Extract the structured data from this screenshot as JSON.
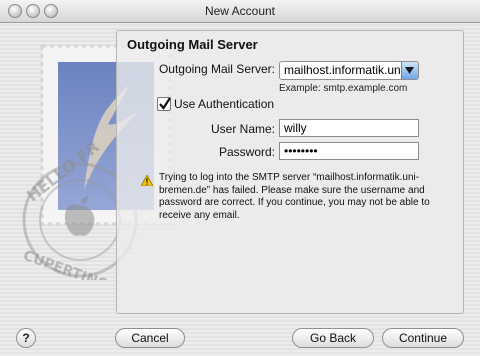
{
  "window": {
    "title": "New Account"
  },
  "panel": {
    "heading": "Outgoing Mail Server",
    "server_label": "Outgoing Mail Server:",
    "server_value": "mailhost.informatik.uni-bremen.de",
    "example": "Example: smtp.example.com",
    "use_auth_label": "Use Authentication",
    "use_auth_checked": true,
    "username_label": "User Name:",
    "username_value": "willy",
    "password_label": "Password:",
    "password_value": "••••••••",
    "warning": "Trying to log into the SMTP server “mailhost.informatik.uni-bremen.de” has failed. Please make sure the username and password are correct. If you continue, you may not be able to receive any email."
  },
  "buttons": {
    "help": "?",
    "cancel": "Cancel",
    "go_back": "Go Back",
    "continue": "Continue"
  },
  "stamp": {
    "text_top": "HELLO FR",
    "text_bottom": "CUPERTINO CA"
  },
  "colors": {
    "popup_arrow": "#6fa7e8",
    "warning": "#f2c200"
  }
}
